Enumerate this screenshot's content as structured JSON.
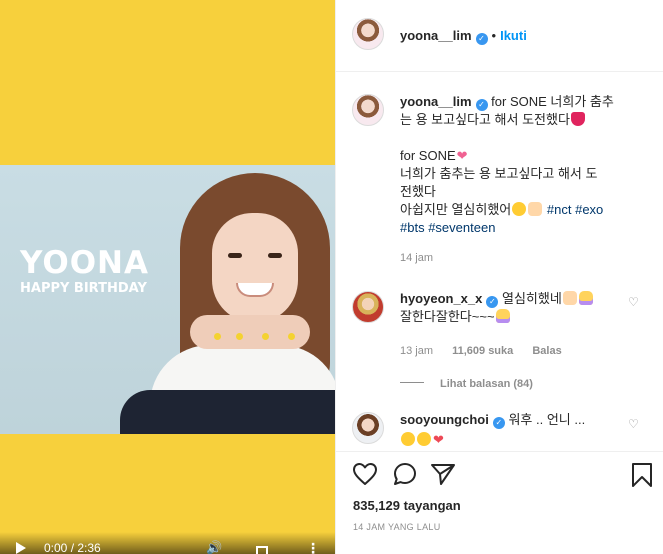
{
  "video": {
    "overlay_title": "YOONA",
    "overlay_subtitle": "HAPPY BIRTHDAY",
    "time": "0:00 / 2:36",
    "background": "#f7d03c"
  },
  "header": {
    "username": "yoona__lim",
    "separator": "•",
    "follow_label": "Ikuti"
  },
  "caption": {
    "username": "yoona__lim",
    "line1": "for SONE 너희가 춤추",
    "line2": "는 용 보고싶다고 해서 도전했다",
    "line3": "for SONE",
    "line4": "너희가 춤추는 용 보고싶다고 해서 도",
    "line5": "전했다",
    "line6": "아쉽지만 열심히했어",
    "tag1": "#nct",
    "tag2": "#exo",
    "tag3": "#bts",
    "tag4": "#seventeen",
    "time": "14 jam"
  },
  "comments": [
    {
      "username": "hyoyeon_x_x",
      "line1": "열심히했네",
      "line2": "잘한다잘한다~~~",
      "time": "13 jam",
      "likes": "11,609 suka",
      "reply_label": "Balas",
      "view_replies": "Lihat balasan (84)"
    },
    {
      "username": "sooyoungchoi",
      "line1": "워후 .. 언니 ..."
    }
  ],
  "footer": {
    "views": "835,129 tayangan",
    "posted": "14 JAM YANG LALU"
  },
  "colors": {
    "accent": "#0095f6",
    "verified": "#3897f0",
    "hashtag": "#00376b",
    "muted": "#8e8e8e"
  }
}
